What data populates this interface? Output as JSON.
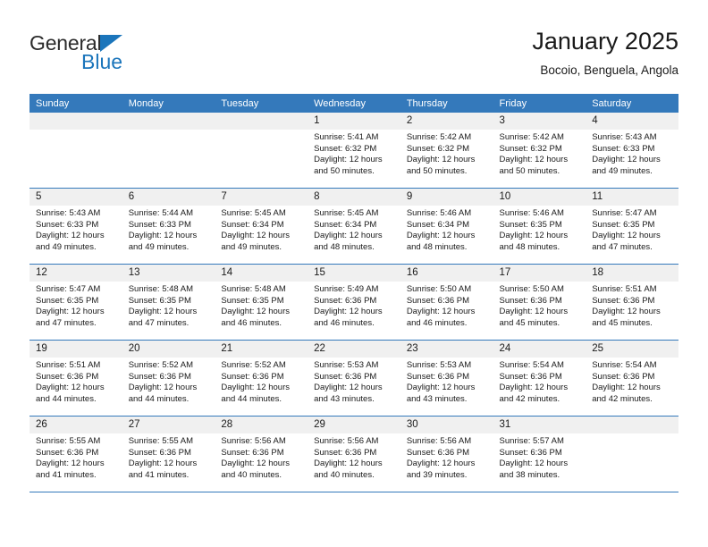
{
  "brand": {
    "name_top": "General",
    "name_bottom": "Blue",
    "accent_color": "#1b75bb"
  },
  "header": {
    "title": "January 2025",
    "subtitle": "Bocoio, Benguela, Angola"
  },
  "theme": {
    "header_row_bg": "#3479bb",
    "header_row_text": "#ffffff",
    "daynum_bg": "#f0f0f0",
    "row_divider": "#3479bb"
  },
  "weekday_headers": [
    "Sunday",
    "Monday",
    "Tuesday",
    "Wednesday",
    "Thursday",
    "Friday",
    "Saturday"
  ],
  "labels": {
    "sunrise_prefix": "Sunrise:",
    "sunset_prefix": "Sunset:",
    "daylight_prefix": "Daylight:"
  },
  "weeks": [
    [
      {
        "day": "",
        "empty": true
      },
      {
        "day": "",
        "empty": true
      },
      {
        "day": "",
        "empty": true
      },
      {
        "day": "1",
        "sunrise": "Sunrise: 5:41 AM",
        "sunset": "Sunset: 6:32 PM",
        "daylight_line1": "Daylight: 12 hours",
        "daylight_line2": "and 50 minutes."
      },
      {
        "day": "2",
        "sunrise": "Sunrise: 5:42 AM",
        "sunset": "Sunset: 6:32 PM",
        "daylight_line1": "Daylight: 12 hours",
        "daylight_line2": "and 50 minutes."
      },
      {
        "day": "3",
        "sunrise": "Sunrise: 5:42 AM",
        "sunset": "Sunset: 6:32 PM",
        "daylight_line1": "Daylight: 12 hours",
        "daylight_line2": "and 50 minutes."
      },
      {
        "day": "4",
        "sunrise": "Sunrise: 5:43 AM",
        "sunset": "Sunset: 6:33 PM",
        "daylight_line1": "Daylight: 12 hours",
        "daylight_line2": "and 49 minutes."
      }
    ],
    [
      {
        "day": "5",
        "sunrise": "Sunrise: 5:43 AM",
        "sunset": "Sunset: 6:33 PM",
        "daylight_line1": "Daylight: 12 hours",
        "daylight_line2": "and 49 minutes."
      },
      {
        "day": "6",
        "sunrise": "Sunrise: 5:44 AM",
        "sunset": "Sunset: 6:33 PM",
        "daylight_line1": "Daylight: 12 hours",
        "daylight_line2": "and 49 minutes."
      },
      {
        "day": "7",
        "sunrise": "Sunrise: 5:45 AM",
        "sunset": "Sunset: 6:34 PM",
        "daylight_line1": "Daylight: 12 hours",
        "daylight_line2": "and 49 minutes."
      },
      {
        "day": "8",
        "sunrise": "Sunrise: 5:45 AM",
        "sunset": "Sunset: 6:34 PM",
        "daylight_line1": "Daylight: 12 hours",
        "daylight_line2": "and 48 minutes."
      },
      {
        "day": "9",
        "sunrise": "Sunrise: 5:46 AM",
        "sunset": "Sunset: 6:34 PM",
        "daylight_line1": "Daylight: 12 hours",
        "daylight_line2": "and 48 minutes."
      },
      {
        "day": "10",
        "sunrise": "Sunrise: 5:46 AM",
        "sunset": "Sunset: 6:35 PM",
        "daylight_line1": "Daylight: 12 hours",
        "daylight_line2": "and 48 minutes."
      },
      {
        "day": "11",
        "sunrise": "Sunrise: 5:47 AM",
        "sunset": "Sunset: 6:35 PM",
        "daylight_line1": "Daylight: 12 hours",
        "daylight_line2": "and 47 minutes."
      }
    ],
    [
      {
        "day": "12",
        "sunrise": "Sunrise: 5:47 AM",
        "sunset": "Sunset: 6:35 PM",
        "daylight_line1": "Daylight: 12 hours",
        "daylight_line2": "and 47 minutes."
      },
      {
        "day": "13",
        "sunrise": "Sunrise: 5:48 AM",
        "sunset": "Sunset: 6:35 PM",
        "daylight_line1": "Daylight: 12 hours",
        "daylight_line2": "and 47 minutes."
      },
      {
        "day": "14",
        "sunrise": "Sunrise: 5:48 AM",
        "sunset": "Sunset: 6:35 PM",
        "daylight_line1": "Daylight: 12 hours",
        "daylight_line2": "and 46 minutes."
      },
      {
        "day": "15",
        "sunrise": "Sunrise: 5:49 AM",
        "sunset": "Sunset: 6:36 PM",
        "daylight_line1": "Daylight: 12 hours",
        "daylight_line2": "and 46 minutes."
      },
      {
        "day": "16",
        "sunrise": "Sunrise: 5:50 AM",
        "sunset": "Sunset: 6:36 PM",
        "daylight_line1": "Daylight: 12 hours",
        "daylight_line2": "and 46 minutes."
      },
      {
        "day": "17",
        "sunrise": "Sunrise: 5:50 AM",
        "sunset": "Sunset: 6:36 PM",
        "daylight_line1": "Daylight: 12 hours",
        "daylight_line2": "and 45 minutes."
      },
      {
        "day": "18",
        "sunrise": "Sunrise: 5:51 AM",
        "sunset": "Sunset: 6:36 PM",
        "daylight_line1": "Daylight: 12 hours",
        "daylight_line2": "and 45 minutes."
      }
    ],
    [
      {
        "day": "19",
        "sunrise": "Sunrise: 5:51 AM",
        "sunset": "Sunset: 6:36 PM",
        "daylight_line1": "Daylight: 12 hours",
        "daylight_line2": "and 44 minutes."
      },
      {
        "day": "20",
        "sunrise": "Sunrise: 5:52 AM",
        "sunset": "Sunset: 6:36 PM",
        "daylight_line1": "Daylight: 12 hours",
        "daylight_line2": "and 44 minutes."
      },
      {
        "day": "21",
        "sunrise": "Sunrise: 5:52 AM",
        "sunset": "Sunset: 6:36 PM",
        "daylight_line1": "Daylight: 12 hours",
        "daylight_line2": "and 44 minutes."
      },
      {
        "day": "22",
        "sunrise": "Sunrise: 5:53 AM",
        "sunset": "Sunset: 6:36 PM",
        "daylight_line1": "Daylight: 12 hours",
        "daylight_line2": "and 43 minutes."
      },
      {
        "day": "23",
        "sunrise": "Sunrise: 5:53 AM",
        "sunset": "Sunset: 6:36 PM",
        "daylight_line1": "Daylight: 12 hours",
        "daylight_line2": "and 43 minutes."
      },
      {
        "day": "24",
        "sunrise": "Sunrise: 5:54 AM",
        "sunset": "Sunset: 6:36 PM",
        "daylight_line1": "Daylight: 12 hours",
        "daylight_line2": "and 42 minutes."
      },
      {
        "day": "25",
        "sunrise": "Sunrise: 5:54 AM",
        "sunset": "Sunset: 6:36 PM",
        "daylight_line1": "Daylight: 12 hours",
        "daylight_line2": "and 42 minutes."
      }
    ],
    [
      {
        "day": "26",
        "sunrise": "Sunrise: 5:55 AM",
        "sunset": "Sunset: 6:36 PM",
        "daylight_line1": "Daylight: 12 hours",
        "daylight_line2": "and 41 minutes."
      },
      {
        "day": "27",
        "sunrise": "Sunrise: 5:55 AM",
        "sunset": "Sunset: 6:36 PM",
        "daylight_line1": "Daylight: 12 hours",
        "daylight_line2": "and 41 minutes."
      },
      {
        "day": "28",
        "sunrise": "Sunrise: 5:56 AM",
        "sunset": "Sunset: 6:36 PM",
        "daylight_line1": "Daylight: 12 hours",
        "daylight_line2": "and 40 minutes."
      },
      {
        "day": "29",
        "sunrise": "Sunrise: 5:56 AM",
        "sunset": "Sunset: 6:36 PM",
        "daylight_line1": "Daylight: 12 hours",
        "daylight_line2": "and 40 minutes."
      },
      {
        "day": "30",
        "sunrise": "Sunrise: 5:56 AM",
        "sunset": "Sunset: 6:36 PM",
        "daylight_line1": "Daylight: 12 hours",
        "daylight_line2": "and 39 minutes."
      },
      {
        "day": "31",
        "sunrise": "Sunrise: 5:57 AM",
        "sunset": "Sunset: 6:36 PM",
        "daylight_line1": "Daylight: 12 hours",
        "daylight_line2": "and 38 minutes."
      },
      {
        "day": "",
        "empty": true
      }
    ]
  ]
}
